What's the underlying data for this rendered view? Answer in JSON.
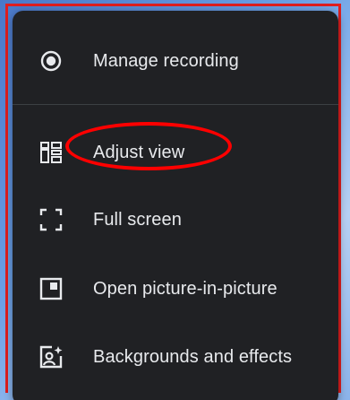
{
  "menu": {
    "items": [
      {
        "label": "Manage recording",
        "icon": "record-icon"
      },
      {
        "label": "Adjust view",
        "icon": "grid-layout-icon"
      },
      {
        "label": "Full screen",
        "icon": "fullscreen-icon"
      },
      {
        "label": "Open picture-in-picture",
        "icon": "picture-in-picture-icon"
      },
      {
        "label": "Backgrounds and effects",
        "icon": "backgrounds-effects-icon"
      }
    ]
  },
  "colors": {
    "menu_background": "#202124",
    "text": "#e8eaed",
    "annotation": "#ff0000"
  }
}
